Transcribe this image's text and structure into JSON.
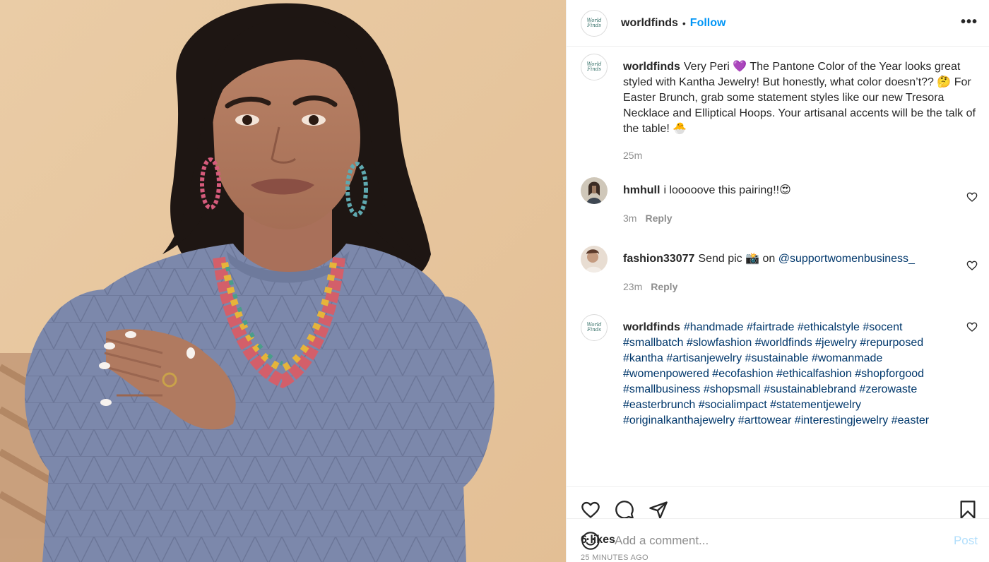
{
  "header": {
    "username": "worldfinds",
    "separator": "•",
    "follow_label": "Follow",
    "more_label": "•••",
    "avatar_logo_text": "World Finds"
  },
  "caption": {
    "username": "worldfinds",
    "text": "Very Peri 💜 The Pantone Color of the Year looks great styled with Kantha Jewelry! But honestly, what color doesn’t?? 🤔 For Easter Brunch, grab some statement styles like our new Tresora Necklace and Elliptical Hoops. Your artisanal accents will be the talk of the table! 🐣",
    "time": "25m"
  },
  "comments": [
    {
      "username": "hmhull",
      "text": "i looooove this pairing!!😍",
      "time": "3m",
      "reply_label": "Reply"
    },
    {
      "username": "fashion33077",
      "text_before": "Send pic 📸 on ",
      "mention": "@supportwomenbusiness_",
      "time": "23m",
      "reply_label": "Reply"
    }
  ],
  "hashtag_comment": {
    "username": "worldfinds",
    "tags": "#handmade #fairtrade #ethicalstyle #socent #smallbatch #slowfashion #worldfinds #jewelry #repurposed #kantha #artisanjewelry #sustainable #womanmade #womenpowered #ecofashion #ethicalfashion #shopforgood #smallbusiness #shopsmall #sustainablebrand #zerowaste #easterbrunch #socialimpact #statementjewelry #originalkanthajewelry #arttowear #interestingjewelry #easter"
  },
  "engagement": {
    "likes": "6 likes",
    "timestamp": "25 MINUTES AGO"
  },
  "add_comment": {
    "placeholder": "Add a comment...",
    "post_label": "Post"
  },
  "colors": {
    "accent": "#0095f6",
    "link": "#00376b",
    "muted": "#8e8e8e",
    "post_disabled": "#b2dffc",
    "sweater": "#7b86a8",
    "background_wall": "#e9c9a1"
  }
}
